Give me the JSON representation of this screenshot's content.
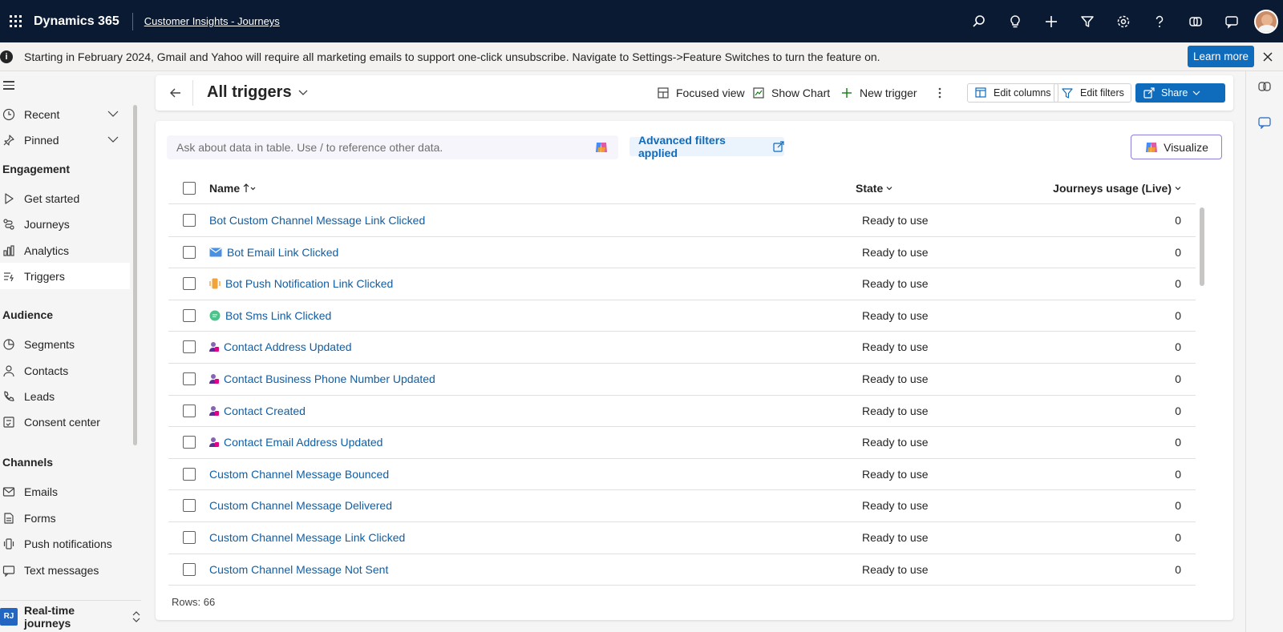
{
  "header": {
    "app_name": "Dynamics 365",
    "area_name": "Customer Insights - Journeys",
    "icons": [
      "search-icon",
      "lightbulb-icon",
      "plus-icon",
      "filter-icon",
      "gear-icon",
      "help-icon",
      "copilot-icon",
      "chat-icon",
      "avatar"
    ]
  },
  "notice": {
    "text": "Starting in February 2024, Gmail and Yahoo will require all marketing emails to support one-click unsubscribe. Navigate to Settings->Feature Switches to turn the feature on.",
    "learn_more": "Learn more"
  },
  "sidebar": {
    "recent": "Recent",
    "pinned": "Pinned",
    "groups": {
      "engagement": "Engagement",
      "audience": "Audience",
      "channels": "Channels"
    },
    "engagement_items": [
      "Get started",
      "Journeys",
      "Analytics",
      "Triggers"
    ],
    "audience_items": [
      "Segments",
      "Contacts",
      "Leads",
      "Consent center"
    ],
    "channel_items": [
      "Emails",
      "Forms",
      "Push notifications",
      "Text messages"
    ],
    "selected": "Triggers",
    "area_badge": "RJ",
    "area_label": "Real-time journeys"
  },
  "commandbar": {
    "view_title": "All triggers",
    "focused_view": "Focused view",
    "show_chart": "Show Chart",
    "new_trigger": "New trigger",
    "edit_columns": "Edit columns",
    "edit_filters": "Edit filters",
    "share": "Share"
  },
  "panel": {
    "ask_placeholder": "Ask about data in table. Use / to reference other data.",
    "advanced_filters": "Advanced filters applied",
    "visualize": "Visualize",
    "columns": {
      "name": "Name",
      "state": "State",
      "usage": "Journeys usage (Live)"
    },
    "rows": [
      {
        "name": "Bot Custom Channel Message Link Clicked",
        "icon": "",
        "state": "Ready to use",
        "usage": "0"
      },
      {
        "name": "Bot Email Link Clicked",
        "icon": "email-icon",
        "state": "Ready to use",
        "usage": "0"
      },
      {
        "name": "Bot Push Notification Link Clicked",
        "icon": "push-notification-icon",
        "state": "Ready to use",
        "usage": "0"
      },
      {
        "name": "Bot Sms Link Clicked",
        "icon": "sms-icon",
        "state": "Ready to use",
        "usage": "0"
      },
      {
        "name": "Contact Address Updated",
        "icon": "contact-icon",
        "state": "Ready to use",
        "usage": "0"
      },
      {
        "name": "Contact Business Phone Number Updated",
        "icon": "contact-icon",
        "state": "Ready to use",
        "usage": "0"
      },
      {
        "name": "Contact Created",
        "icon": "contact-icon",
        "state": "Ready to use",
        "usage": "0"
      },
      {
        "name": "Contact Email Address Updated",
        "icon": "contact-icon",
        "state": "Ready to use",
        "usage": "0"
      },
      {
        "name": "Custom Channel Message Bounced",
        "icon": "",
        "state": "Ready to use",
        "usage": "0"
      },
      {
        "name": "Custom Channel Message Delivered",
        "icon": "",
        "state": "Ready to use",
        "usage": "0"
      },
      {
        "name": "Custom Channel Message Link Clicked",
        "icon": "",
        "state": "Ready to use",
        "usage": "0"
      },
      {
        "name": "Custom Channel Message Not Sent",
        "icon": "",
        "state": "Ready to use",
        "usage": "0"
      }
    ],
    "rows_count": "Rows: 66"
  },
  "colors": {
    "topbar": "#0b1a33",
    "accent": "#0f6cbd",
    "link": "#115ea3"
  }
}
